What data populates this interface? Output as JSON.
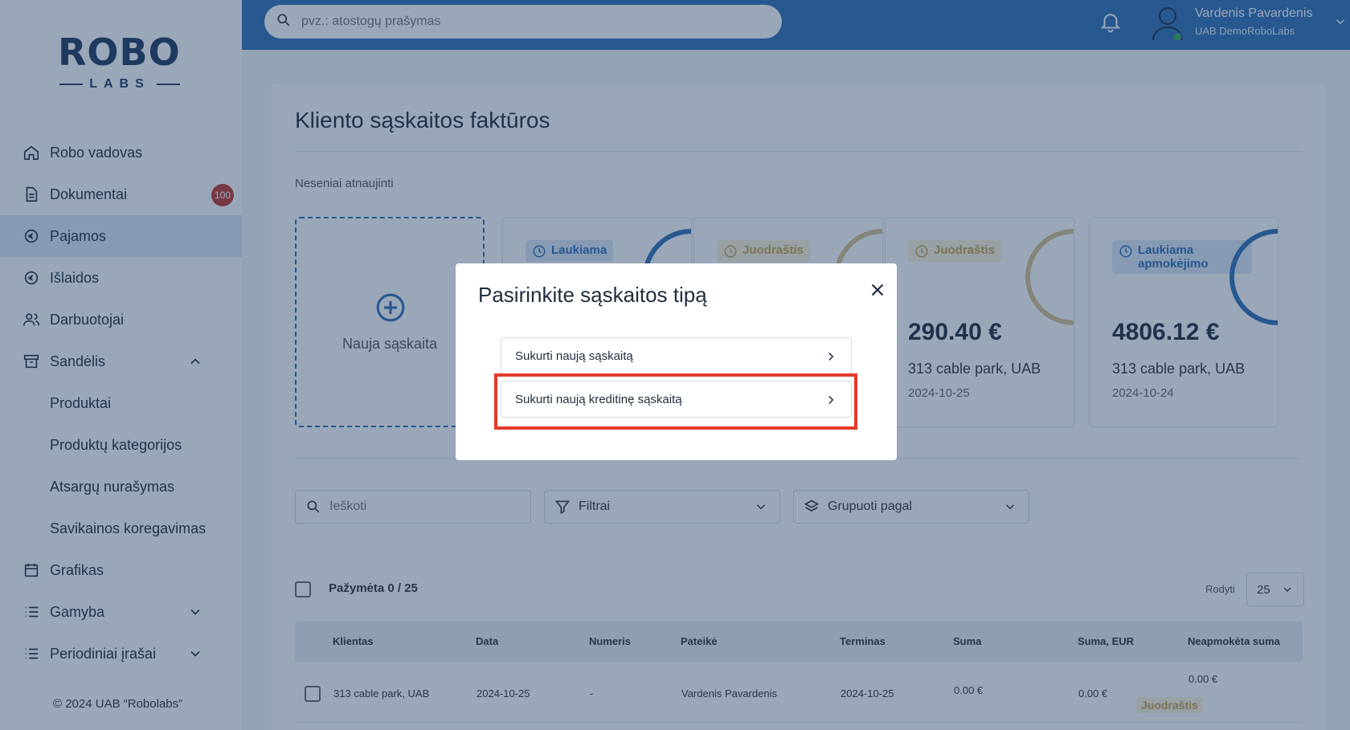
{
  "logo": {
    "brand": "ROBO",
    "sub": "LABS"
  },
  "sidebar": {
    "items": [
      {
        "label": "Robo vadovas",
        "icon": "home-icon"
      },
      {
        "label": "Dokumentai",
        "icon": "document-icon",
        "badge": "100"
      },
      {
        "label": "Pajamos",
        "icon": "income-icon",
        "active": true
      },
      {
        "label": "Išlaidos",
        "icon": "expense-icon"
      },
      {
        "label": "Darbuotojai",
        "icon": "people-icon"
      },
      {
        "label": "Sandėlis",
        "icon": "warehouse-icon",
        "expanded": true
      },
      {
        "label": "Produktai",
        "sub": true
      },
      {
        "label": "Produktų kategorijos",
        "sub": true
      },
      {
        "label": "Atsargų nurašymas",
        "sub": true
      },
      {
        "label": "Savikainos koregavimas",
        "sub": true
      },
      {
        "label": "Grafikas",
        "icon": "calendar-icon"
      },
      {
        "label": "Gamyba",
        "icon": "list-icon",
        "collapsed": true
      },
      {
        "label": "Periodiniai įrašai",
        "icon": "list-icon",
        "collapsed": true
      }
    ],
    "copyright": "© 2024 UAB “Robolabs”"
  },
  "topbar": {
    "search_placeholder": "pvz.: atostogų prašymas",
    "user_name": "Vardenis Pavardenis",
    "user_company": "UAB DemoRoboLabs"
  },
  "page": {
    "title": "Kliento sąskaitos faktūros",
    "recent_label": "Neseniai atnaujinti",
    "new_invoice_label": "Nauja sąskaita",
    "cards": [
      {
        "status": "Laukiama",
        "kind": "pending"
      },
      {
        "status": "Juodraštis",
        "kind": "draft"
      },
      {
        "status": "Juodraštis",
        "kind": "draft",
        "amount": "290.40 €",
        "client": "313 cable park, UAB",
        "date": "2024-10-25"
      },
      {
        "status": "Laukiama apmokėjimo",
        "kind": "pending",
        "amount": "4806.12 €",
        "client": "313 cable park, UAB",
        "date": "2024-10-24"
      }
    ]
  },
  "filters": {
    "search_placeholder": "Ieškoti",
    "filters_label": "Filtrai",
    "group_label": "Grupuoti pagal"
  },
  "table": {
    "selected_label": "Pažymėta 0 / 25",
    "show_label": "Rodyti",
    "page_size": "25",
    "headers": [
      "Klientas",
      "Data",
      "Numeris",
      "Pateikė",
      "Terminas",
      "Suma",
      "Suma, EUR",
      "Neapmokėta suma"
    ],
    "rows": [
      {
        "client": "313 cable park, UAB",
        "date": "2024-10-25",
        "number": "-",
        "submitted_by": "Vardenis Pavardenis",
        "due": "2024-10-25",
        "sum": "0.00 €",
        "sum_eur": "0.00 €",
        "unpaid": "0.00 €",
        "status": "Juodraštis"
      }
    ]
  },
  "modal": {
    "title": "Pasirinkite sąskaitos tipą",
    "options": [
      "Sukurti naują sąskaitą",
      "Sukurti naują kreditinę sąskaitą"
    ],
    "highlight_color": "#e53a2a"
  },
  "colors": {
    "accent": "#2f6fb5",
    "badge": "#c0392b",
    "draft": "#c9a24a"
  }
}
